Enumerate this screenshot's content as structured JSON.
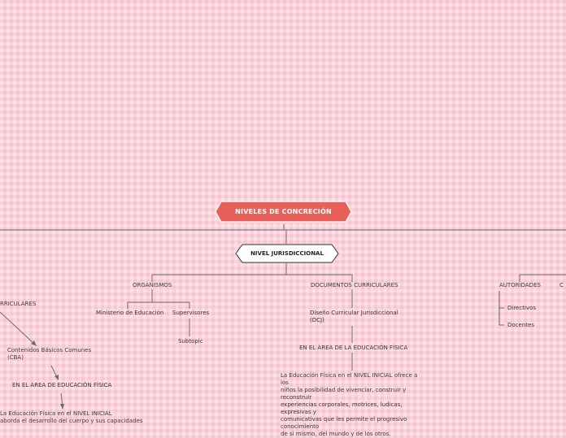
{
  "main_topic": "NIVELES DE CONCRECIÓN",
  "sub_topic": "NIVEL JURISDICCIONAL",
  "branches": {
    "organismos": "ORGANISMOS",
    "ministerio": "Ministerio de Educación",
    "supervisores": "Supervisores",
    "subtopic": "Subtopic",
    "documentos": "DOCUMENTOS CURRICULARES",
    "dcj_line1": "Diseño Curricular Jurisdiccional",
    "dcj_line2": "(DCJ)",
    "area_ef": "EN EL ÁREA DE LA EDUCACIÓN FÍSICA",
    "ef_paragraph": [
      "La Educación Física en el NIVEL INICIAL ofrece a los",
      "niños la posibilidad de vivenciar, construir y",
      "reconstruir",
      "experiencias corporales, motrices, ludicas,",
      "expresivas y",
      "comunicativas que les permite el progresivo",
      "conocimiento",
      "de si mismo, del mundo y de los otros."
    ],
    "autoridades": "AUTORIDADES",
    "directivos": "Directivos",
    "docentes": "Docentes",
    "right_cut": "C"
  },
  "left_branch": {
    "curriculares_cut": "RRICULARES",
    "cba_line1": "Contenidos Básicos Comunes",
    "cba_line2": "(CBA)",
    "area_ef": "EN EL ÁREA DE EDUCACIÓN FÍSICA",
    "inicial_line1": "La Educación Física en el NIVEL INICIAL",
    "inicial_line2": "aborda el desarrollo del cuerpo y sus capacidades"
  },
  "colors": {
    "main_fill": "#e8605a",
    "main_border": "#ffffff",
    "sub_fill": "#ffffff",
    "sub_border": "#333333",
    "line": "#6b6b6b"
  }
}
